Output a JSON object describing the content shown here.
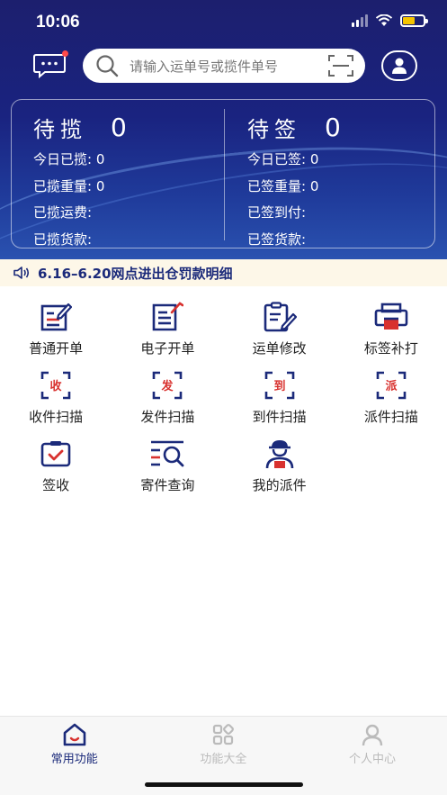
{
  "status_bar": {
    "time": "10:06"
  },
  "search": {
    "placeholder": "请输入运单号或揽件单号"
  },
  "stats": {
    "collected": {
      "title": "待揽",
      "count": "0",
      "lines": [
        "今日已揽: 0",
        "已揽重量: 0",
        "已揽运费:",
        "已揽货款:"
      ]
    },
    "signed": {
      "title": "待签",
      "count": "0",
      "lines": [
        "今日已签: 0",
        "已签重量: 0",
        "已签到付:",
        "已签货款:"
      ]
    }
  },
  "notice": {
    "text": "6.16–6.20网点进出仓罚款明细"
  },
  "functions": [
    {
      "label": "普通开单",
      "icon": "form-edit-icon"
    },
    {
      "label": "电子开单",
      "icon": "document-edit-icon"
    },
    {
      "label": "运单修改",
      "icon": "clipboard-edit-icon"
    },
    {
      "label": "标签补打",
      "icon": "printer-icon"
    },
    {
      "label": "收件扫描",
      "icon": "scan-receive-icon",
      "badge": "收"
    },
    {
      "label": "发件扫描",
      "icon": "scan-send-icon",
      "badge": "发"
    },
    {
      "label": "到件扫描",
      "icon": "scan-arrive-icon",
      "badge": "到"
    },
    {
      "label": "派件扫描",
      "icon": "scan-dispatch-icon",
      "badge": "派"
    },
    {
      "label": "签收",
      "icon": "sign-check-icon"
    },
    {
      "label": "寄件查询",
      "icon": "search-list-icon"
    },
    {
      "label": "我的派件",
      "icon": "courier-icon"
    }
  ],
  "tabs": [
    {
      "label": "常用功能",
      "icon": "home-icon",
      "active": true
    },
    {
      "label": "功能大全",
      "icon": "grid-icon",
      "active": false
    },
    {
      "label": "个人中心",
      "icon": "person-icon",
      "active": false
    }
  ],
  "colors": {
    "primary": "#1b2a7a",
    "accent": "#d8322f",
    "notice_bg": "#fdf7e8"
  }
}
